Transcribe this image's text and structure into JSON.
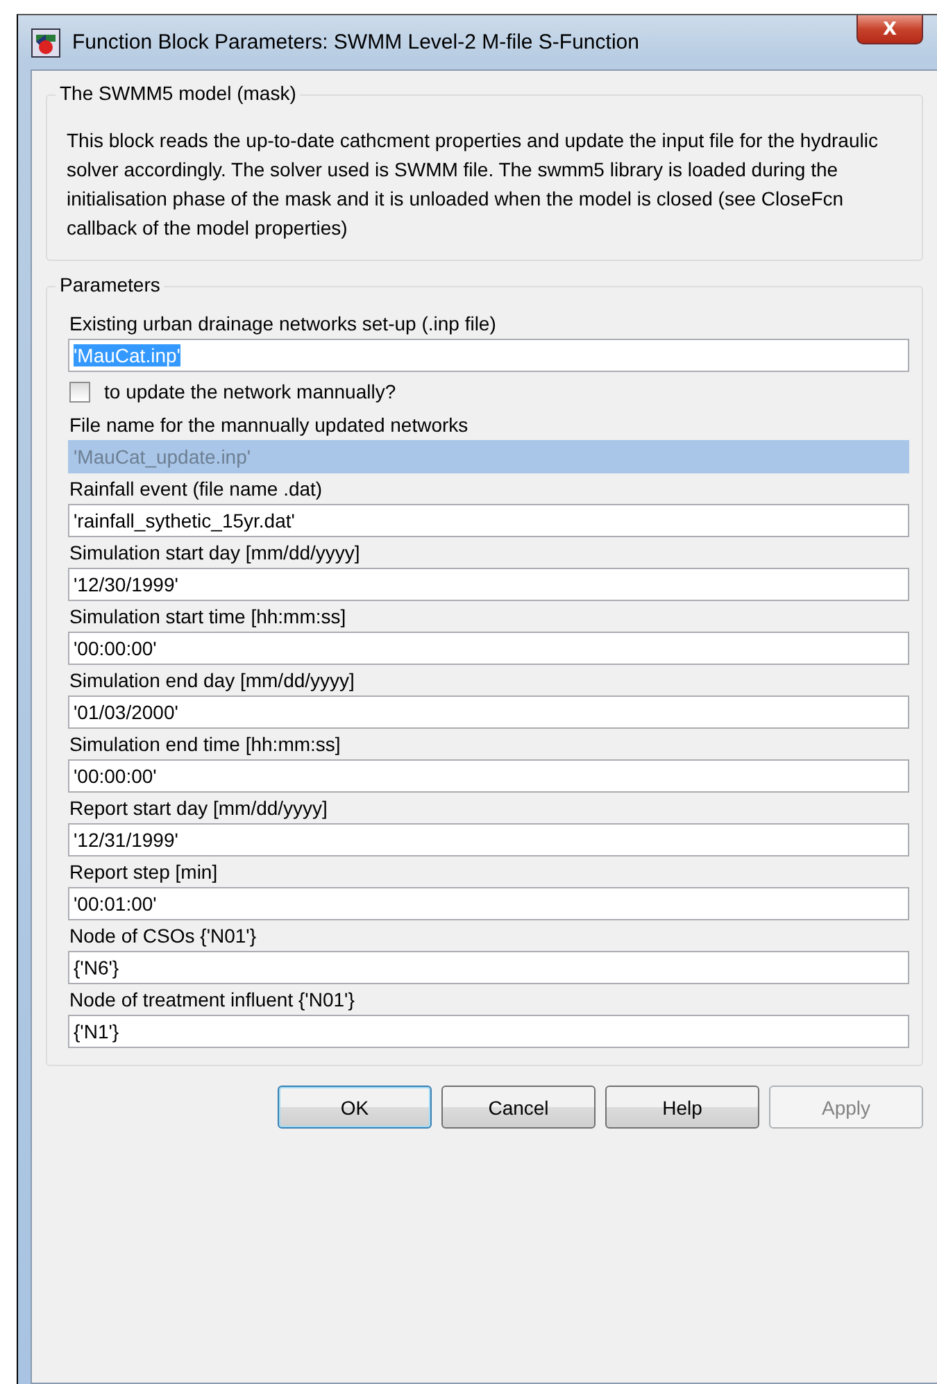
{
  "window": {
    "title": "Function Block Parameters: SWMM Level-2 M-file S-Function",
    "close": "X"
  },
  "mask": {
    "title": "The SWMM5 model (mask)",
    "description": "This block reads the up-to-date cathcment properties and update the input file for the hydraulic solver accordingly. The solver used is SWMM file. The swmm5 library is loaded during the initialisation phase of the mask and it is unloaded when the model is closed (see CloseFcn callback of the model properties)"
  },
  "parameters": {
    "title": "Parameters",
    "items": [
      {
        "kind": "field",
        "label": "Existing urban drainage networks set-up (.inp file)",
        "value": "'MauCat.inp'",
        "selected": true,
        "disabled": false
      },
      {
        "kind": "checkbox",
        "label": "to update the network mannually?",
        "checked": false
      },
      {
        "kind": "field",
        "label": "File name for the mannually updated networks",
        "value": "'MauCat_update.inp'",
        "selected": false,
        "disabled": true
      },
      {
        "kind": "field",
        "label": "Rainfall event (file name .dat)",
        "value": "'rainfall_sythetic_15yr.dat'",
        "selected": false,
        "disabled": false
      },
      {
        "kind": "field",
        "label": "Simulation start day [mm/dd/yyyy]",
        "value": "'12/30/1999'",
        "selected": false,
        "disabled": false
      },
      {
        "kind": "field",
        "label": "Simulation start time [hh:mm:ss]",
        "value": "'00:00:00'",
        "selected": false,
        "disabled": false
      },
      {
        "kind": "field",
        "label": "Simulation end day [mm/dd/yyyy]",
        "value": "'01/03/2000'",
        "selected": false,
        "disabled": false
      },
      {
        "kind": "field",
        "label": "Simulation end time [hh:mm:ss]",
        "value": "'00:00:00'",
        "selected": false,
        "disabled": false
      },
      {
        "kind": "field",
        "label": "Report start day [mm/dd/yyyy]",
        "value": "'12/31/1999'",
        "selected": false,
        "disabled": false
      },
      {
        "kind": "field",
        "label": "Report step [min]",
        "value": "'00:01:00'",
        "selected": false,
        "disabled": false
      },
      {
        "kind": "field",
        "label": "Node of CSOs {'N01'}",
        "value": "{'N6'}",
        "selected": false,
        "disabled": false
      },
      {
        "kind": "field",
        "label": "Node of treatment influent {'N01'}",
        "value": "{'N1'}",
        "selected": false,
        "disabled": false
      }
    ]
  },
  "buttons": [
    {
      "label": "OK",
      "default": true,
      "disabled": false
    },
    {
      "label": "Cancel",
      "default": false,
      "disabled": false
    },
    {
      "label": "Help",
      "default": false,
      "disabled": false
    },
    {
      "label": "Apply",
      "default": false,
      "disabled": true
    }
  ]
}
